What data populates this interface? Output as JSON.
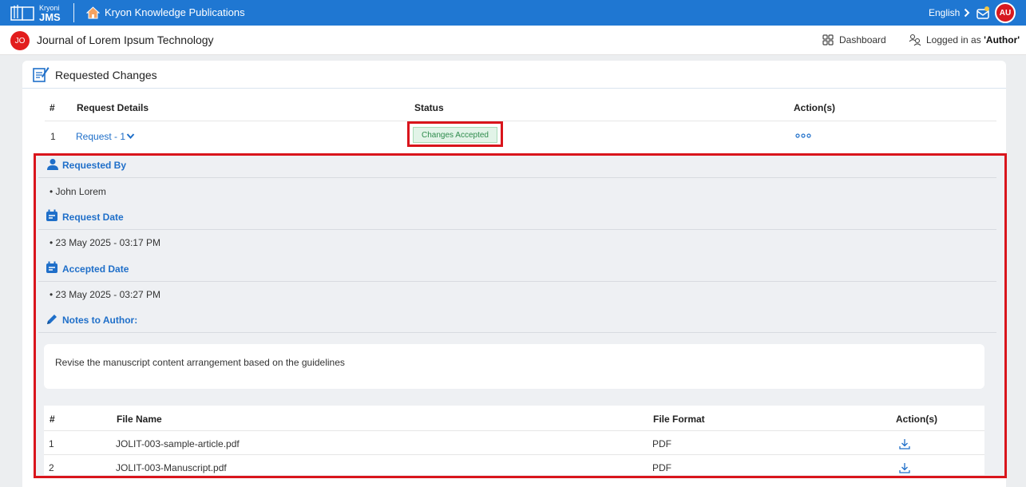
{
  "topbar": {
    "brand_small": "Kryoni",
    "brand_big": "JMS",
    "publisher": "Kryon Knowledge Publications",
    "language": "English",
    "user_initials": "AU"
  },
  "header": {
    "journal_initials": "JO",
    "journal_title": "Journal of Lorem Ipsum Technology",
    "dashboard_label": "Dashboard",
    "logged_prefix": "Logged in as ",
    "logged_role": "'Author'"
  },
  "card": {
    "title": "Requested Changes",
    "columns": [
      "#",
      "Request Details",
      "Status",
      "Action(s)"
    ],
    "request": {
      "index": "1",
      "label": "Request - 1",
      "status": "Changes Accepted"
    }
  },
  "details": {
    "requested_by_label": "Requested By",
    "requested_by": "John Lorem",
    "request_date_label": "Request Date",
    "request_date": "23 May 2025 - 03:17 PM",
    "accepted_date_label": "Accepted Date",
    "accepted_date": "23 May 2025 - 03:27 PM",
    "notes_label": "Notes to Author:",
    "notes": "Revise the manuscript content arrangement based on the guidelines"
  },
  "files": {
    "columns": [
      "#",
      "File Name",
      "File Format",
      "Action(s)"
    ],
    "rows": [
      {
        "index": "1",
        "name": "JOLIT-003-sample-article.pdf",
        "format": "PDF"
      },
      {
        "index": "2",
        "name": "JOLIT-003-Manuscript.pdf",
        "format": "PDF"
      }
    ]
  },
  "colors": {
    "topbar": "#1f77d2",
    "link": "#1f6fc9",
    "highlight": "#d9151c",
    "status_bg": "#e2f4e8",
    "status_text": "#2e8b4c"
  },
  "icons": [
    "book-logo-icon",
    "home-icon",
    "chevron-right-icon",
    "mail-icon",
    "dashboard-grid-icon",
    "user-switch-icon",
    "edit-document-icon",
    "chevron-down-icon",
    "more-dots-icon",
    "user-icon",
    "calendar-icon",
    "pencil-icon",
    "download-icon"
  ]
}
